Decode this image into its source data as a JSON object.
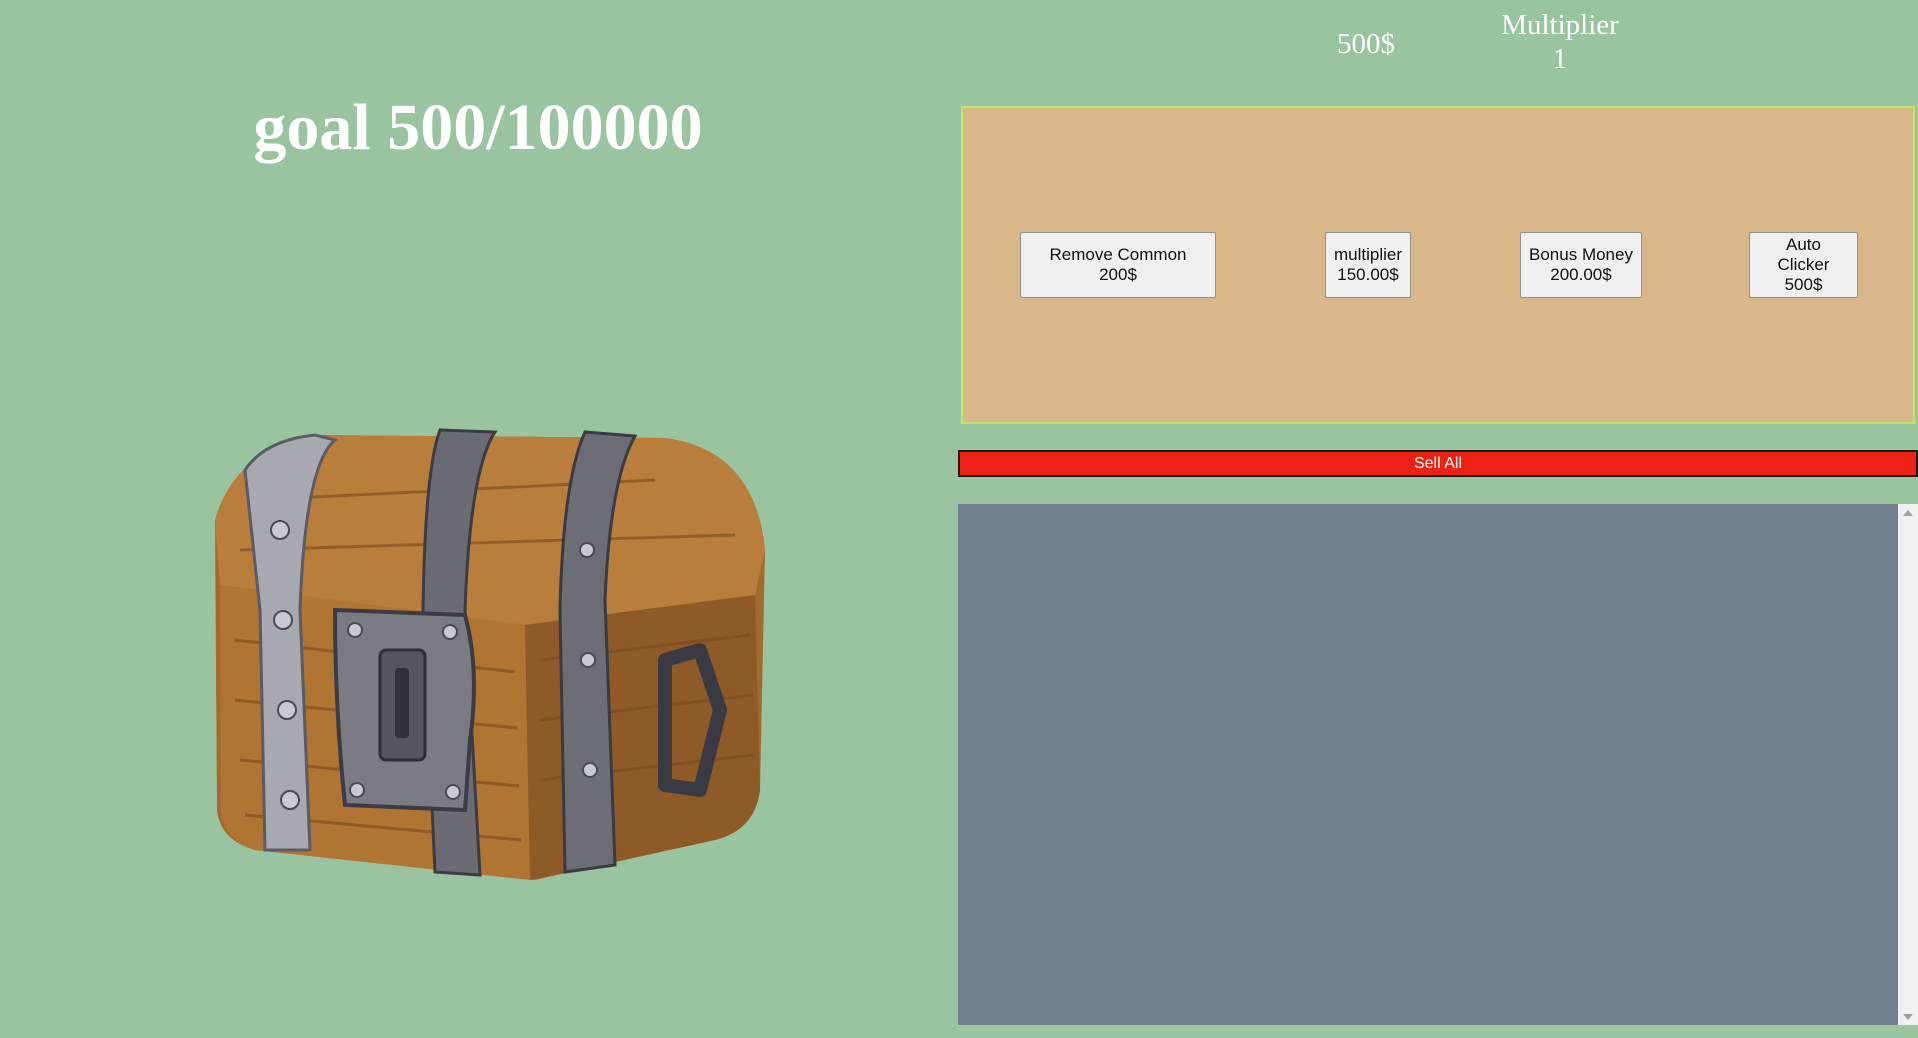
{
  "goal": {
    "text": "goal 500/100000"
  },
  "money": {
    "text": "500$"
  },
  "multiplier": {
    "label": "Multiplier",
    "value": "1"
  },
  "shop": {
    "items": [
      {
        "line1": "Remove Common 200$",
        "line2": ""
      },
      {
        "line1": "multiplier",
        "line2": "150.00$"
      },
      {
        "line1": "Bonus Money",
        "line2": "200.00$"
      },
      {
        "line1": "Auto Clicker",
        "line2": "500$"
      }
    ]
  },
  "sell_all": {
    "label": "Sell All"
  },
  "colors": {
    "background": "#9ac49f",
    "shop_panel": "#d8b889",
    "shop_border": "#bde86a",
    "sell_button": "#ee2214",
    "inventory": "#727f8e"
  },
  "icons": {
    "chest": "treasure-chest-icon",
    "scroll_up": "scroll-up-arrow-icon",
    "scroll_down": "scroll-down-arrow-icon"
  }
}
